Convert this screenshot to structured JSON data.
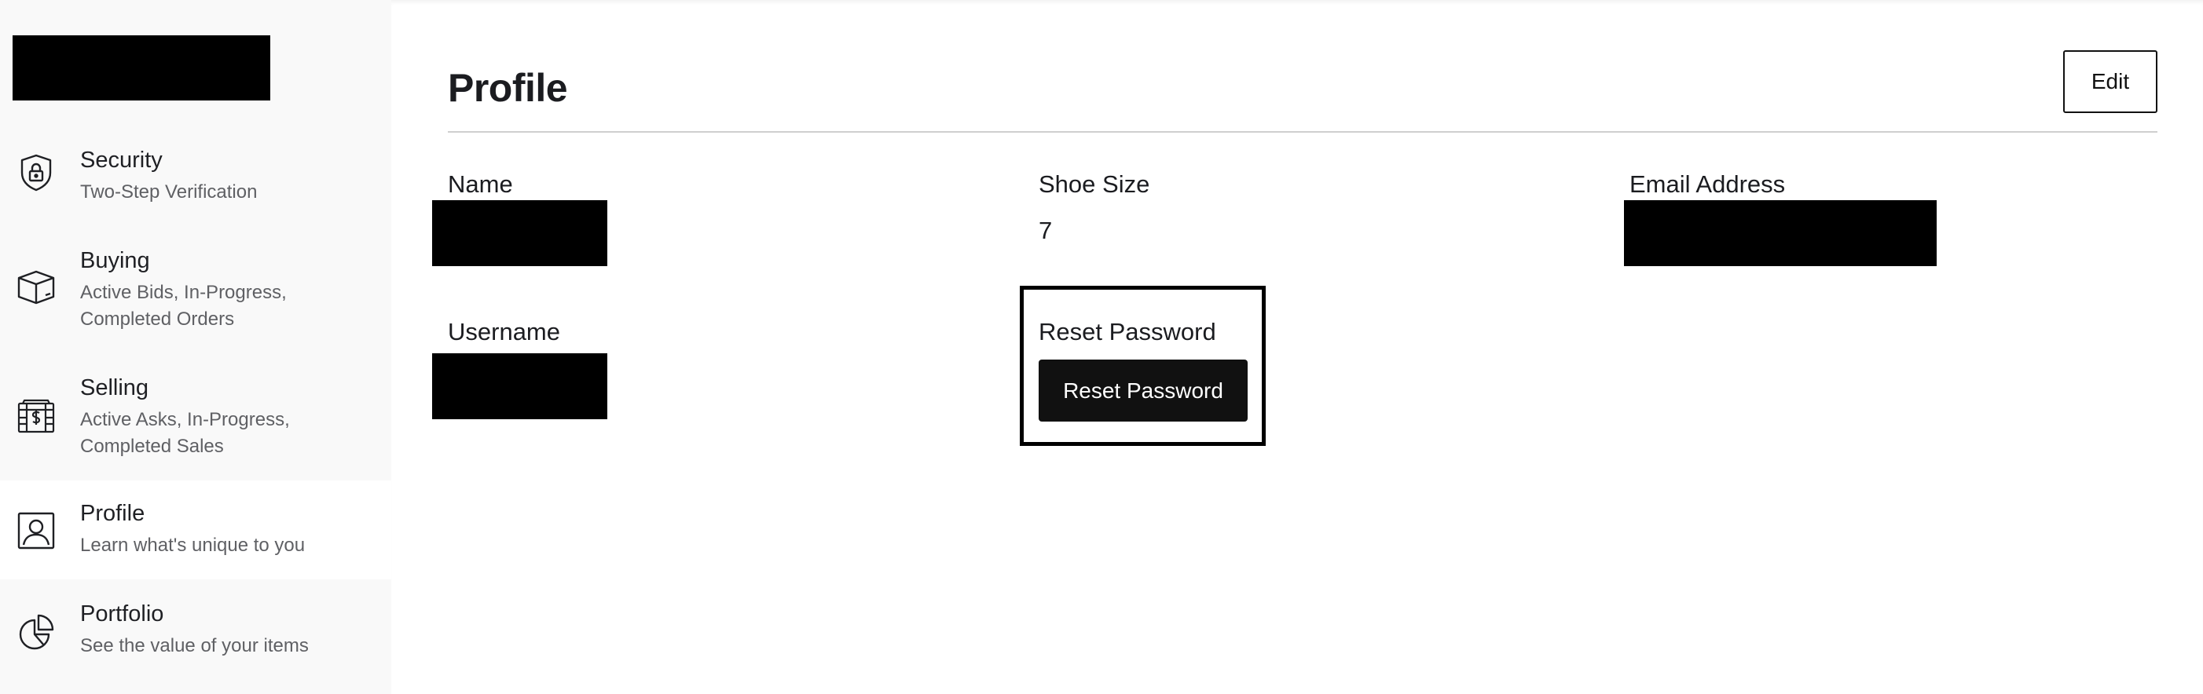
{
  "sidebar": {
    "items": [
      {
        "title": "Security",
        "desc": "Two-Step Verification",
        "icon": "shield-lock-icon"
      },
      {
        "title": "Buying",
        "desc": "Active Bids, In-Progress, Completed Orders",
        "icon": "box-icon"
      },
      {
        "title": "Selling",
        "desc": "Active Asks, In-Progress, Completed Sales",
        "icon": "cash-register-icon"
      },
      {
        "title": "Profile",
        "desc": "Learn what's unique to you",
        "icon": "profile-card-icon",
        "active": true
      },
      {
        "title": "Portfolio",
        "desc": "See the value of your items",
        "icon": "pie-chart-icon"
      }
    ]
  },
  "main": {
    "title": "Profile",
    "edit_label": "Edit",
    "fields": {
      "name_label": "Name",
      "shoe_size_label": "Shoe Size",
      "shoe_size_value": "7",
      "email_label": "Email Address",
      "username_label": "Username",
      "reset_password_label": "Reset Password",
      "reset_password_button": "Reset Password"
    }
  }
}
